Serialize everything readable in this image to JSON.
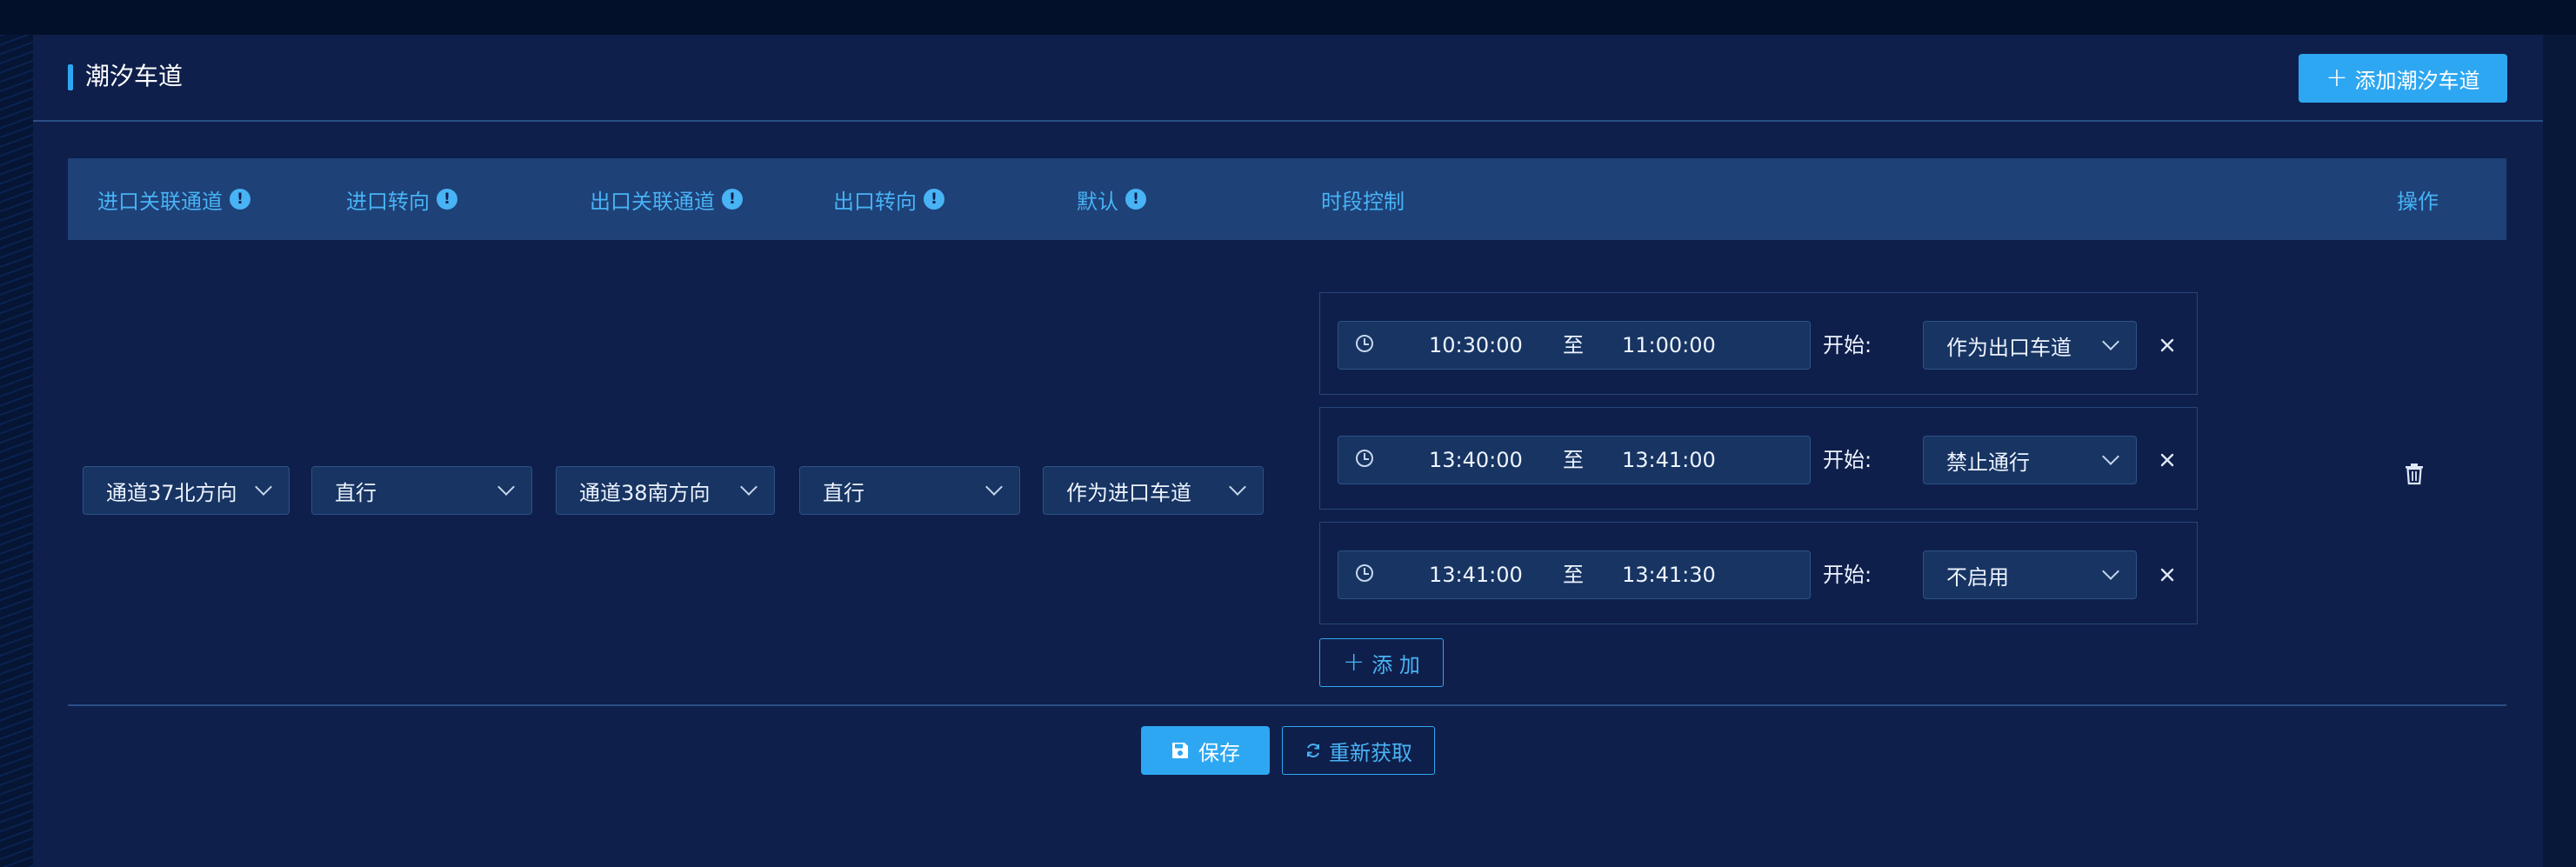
{
  "header": {
    "title": "潮汐车道",
    "add_button_label": "添加潮汐车道",
    "add_button_icon": "plus-icon"
  },
  "table": {
    "columns": {
      "entry_channel": "进口关联通道",
      "entry_turn": "进口转向",
      "exit_channel": "出口关联通道",
      "exit_turn": "出口转向",
      "default": "默认",
      "time_control": "时段控制",
      "actions": "操作"
    },
    "row": {
      "entry_channel": "通道37北方向",
      "entry_turn": "直行",
      "exit_channel": "通道38南方向",
      "exit_turn": "直行",
      "default": "作为进口车道",
      "periods": [
        {
          "start": "10:30:00",
          "separator": "至",
          "end": "11:00:00",
          "start_label": "开始:",
          "mode": "作为出口车道"
        },
        {
          "start": "13:40:00",
          "separator": "至",
          "end": "13:41:00",
          "start_label": "开始:",
          "mode": "禁止通行"
        },
        {
          "start": "13:41:00",
          "separator": "至",
          "end": "13:41:30",
          "start_label": "开始:",
          "mode": "不启用"
        }
      ],
      "add_period_label": "添 加"
    }
  },
  "footer": {
    "save_label": "保存",
    "refresh_label": "重新获取"
  },
  "colors": {
    "accent": "#2ea7f2",
    "header_text": "#48b3f5",
    "panel_bg": "#0f1f4b",
    "table_header_bg": "#1e4178"
  }
}
